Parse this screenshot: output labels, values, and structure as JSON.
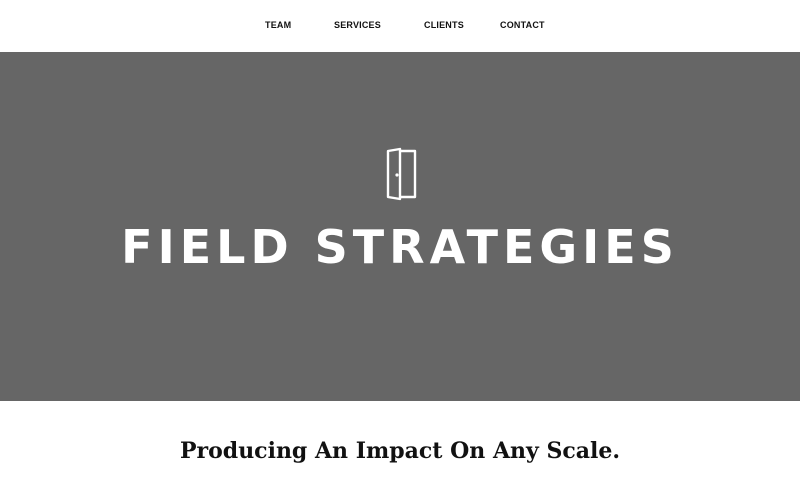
{
  "nav": {
    "items": [
      {
        "label": "TEAM"
      },
      {
        "label": "SERVICES"
      },
      {
        "label": "CLIENTS"
      },
      {
        "label": "CONTACT"
      }
    ]
  },
  "hero": {
    "icon": "door-icon",
    "title": "FIELD STRATEGIES",
    "background_color": "#666666",
    "text_color": "#ffffff"
  },
  "tagline": {
    "text": "Producing An Impact On Any Scale."
  }
}
